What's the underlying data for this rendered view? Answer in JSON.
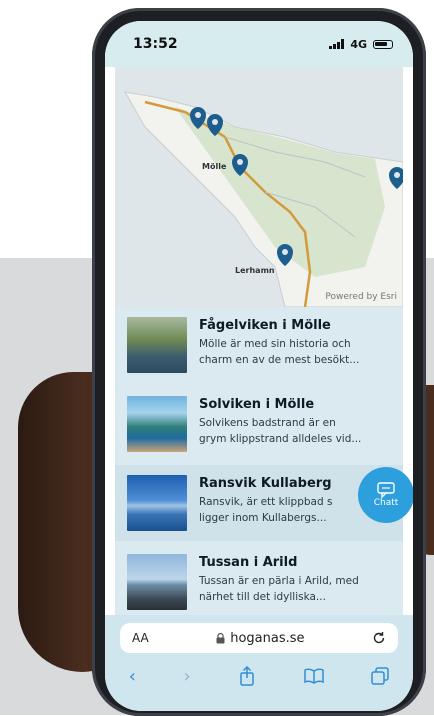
{
  "status_bar": {
    "time": "13:52",
    "network": "4G"
  },
  "map": {
    "labels": {
      "molle": "Mölle",
      "lerhamn": "Lerhamn"
    },
    "attribution": "Powered by Esri",
    "marker_icon": "map-pin-icon"
  },
  "places": [
    {
      "title": "Fågelviken i Mölle",
      "desc_line1": "Mölle är med sin historia och",
      "desc_line2": "charm en av de mest besökt..."
    },
    {
      "title": "Solviken i Mölle",
      "desc_line1": "Solvikens badstrand är en",
      "desc_line2": "grym klippstrand alldeles vid..."
    },
    {
      "title": "Ransvik Kullaberg",
      "desc_line1": "Ransvik, är ett klippbad s",
      "desc_line2": "ligger inom Kullabergs..."
    },
    {
      "title": "Tussan i Arild",
      "desc_line1": "Tussan är en pärla i Arild, med",
      "desc_line2": "närhet till det idylliska..."
    }
  ],
  "chat": {
    "label": "Chatt",
    "icon": "chat-bubble-icon"
  },
  "browser": {
    "text_size_label": "AA",
    "url": "hoganas.se",
    "icons": [
      "lock-icon",
      "reload-icon",
      "back-icon",
      "forward-icon",
      "share-icon",
      "bookmarks-icon",
      "tabs-icon"
    ]
  },
  "colors": {
    "accent": "#2e9fdd",
    "marker": "#1e5e8e",
    "road": "#d39a3a",
    "header_bg": "#d7ecef"
  }
}
